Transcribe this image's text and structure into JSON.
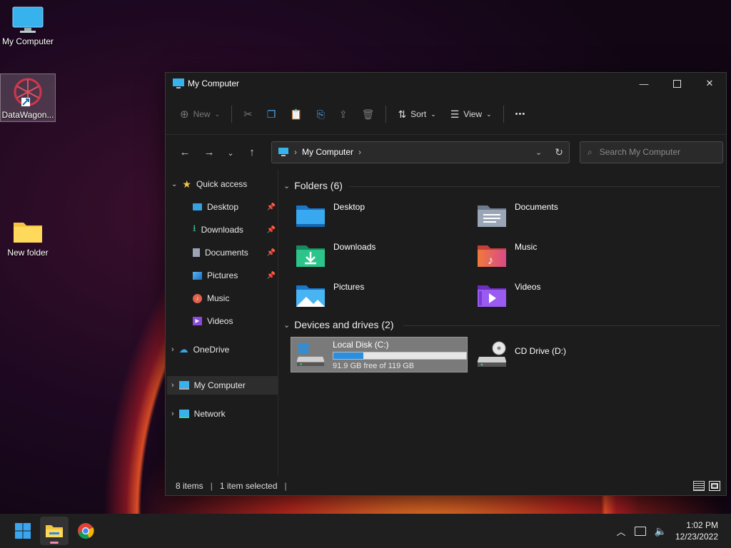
{
  "desktop": {
    "icons": [
      {
        "label": "My Computer"
      },
      {
        "label": "DataWagon..."
      },
      {
        "label": "New folder"
      }
    ]
  },
  "window": {
    "title": "My Computer",
    "toolbar": {
      "new_label": "New",
      "sort_label": "Sort",
      "view_label": "View",
      "more_label": "•••"
    },
    "address": {
      "crumb": "My Computer",
      "search_placeholder": "Search My Computer"
    },
    "sidebar": {
      "quick_access": "Quick access",
      "items": [
        {
          "label": "Desktop"
        },
        {
          "label": "Downloads"
        },
        {
          "label": "Documents"
        },
        {
          "label": "Pictures"
        },
        {
          "label": "Music"
        },
        {
          "label": "Videos"
        }
      ],
      "onedrive": "OneDrive",
      "mycomputer": "My Computer",
      "network": "Network"
    },
    "folders_header": "Folders (6)",
    "folders": [
      {
        "name": "Desktop"
      },
      {
        "name": "Documents"
      },
      {
        "name": "Downloads"
      },
      {
        "name": "Music"
      },
      {
        "name": "Pictures"
      },
      {
        "name": "Videos"
      }
    ],
    "devices_header": "Devices and drives (2)",
    "drives": [
      {
        "name": "Local Disk (C:)",
        "free_text": "91.9 GB free of 119 GB",
        "used_fraction": 0.228
      },
      {
        "name": "CD Drive (D:)"
      }
    ],
    "status": {
      "items": "8 items",
      "selected": "1 item selected"
    }
  },
  "taskbar": {
    "time": "1:02 PM",
    "date": "12/23/2022"
  },
  "colors": {
    "accent": "#1e90d6",
    "selection": "#7a7a7a"
  }
}
